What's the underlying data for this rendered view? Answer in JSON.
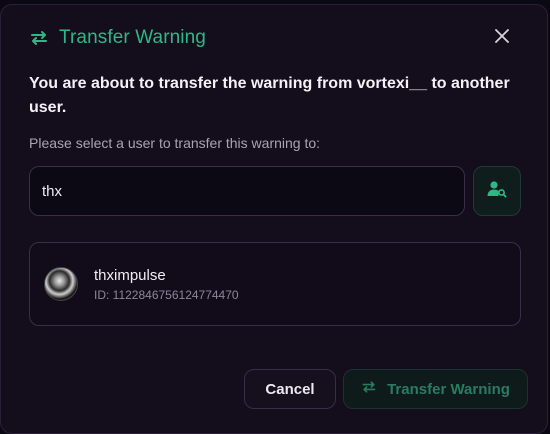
{
  "dialog": {
    "title": "Transfer Warning",
    "message": "You are about to transfer the warning from vortexi__ to another user.",
    "instruction": "Please select a user to transfer this warning to:",
    "search": {
      "value": "thx"
    },
    "results": [
      {
        "username": "thximpulse",
        "id": "ID: 1122846756124774470"
      }
    ],
    "buttons": {
      "cancel": "Cancel",
      "transfer": "Transfer Warning"
    }
  },
  "colors": {
    "accent": "#2fb886",
    "accent_disabled": "#2a7c60",
    "background": "#130d1c",
    "border": "#3a2d4a"
  },
  "icons": {
    "title": "transfer-arrows-icon",
    "close": "close-icon",
    "search": "user-search-icon",
    "transfer_button": "transfer-arrows-icon"
  }
}
